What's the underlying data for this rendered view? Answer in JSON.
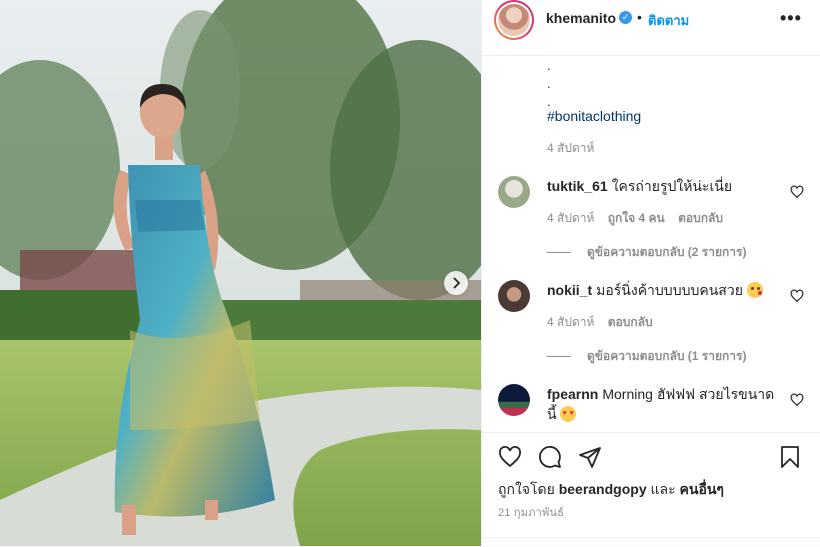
{
  "post": {
    "username": "khemanito",
    "follow_label": "ติดตาม",
    "separator": "•",
    "more_label": "•••",
    "verified_mark": "✓",
    "next_icon": "chevron-right-icon"
  },
  "caption": {
    "dots": [
      ".",
      ".",
      "."
    ],
    "hashtag": "#bonitaclothing",
    "time": "4 สัปดาห์"
  },
  "comments": [
    {
      "username": "tuktik_61",
      "text": "ใครถ่ายรูปให้น่ะเนี่ย",
      "time": "4 สัปดาห์",
      "likes": "ถูกใจ 4 คน",
      "reply": "ตอบกลับ",
      "view_replies": "ดูข้อความตอบกลับ (2 รายการ)"
    },
    {
      "username": "nokii_t",
      "text": "มอร์นิ่งค้าบบบบบคนสวย",
      "emoji": "kissing-face",
      "time": "4 สัปดาห์",
      "reply": "ตอบกลับ",
      "view_replies": "ดูข้อความตอบกลับ (1 รายการ)"
    },
    {
      "username": "fpearnn",
      "text": "Morning ฮัฟฟฟ สวยไรขนาดนี้",
      "emoji": "heart-eyes-face"
    }
  ],
  "footer": {
    "liked_prefix": "ถูกใจโดย",
    "liked_user": "beerandgopy",
    "liked_and": "และ",
    "liked_others": "คนอื่นๆ",
    "date": "21 กุมภาพันธ์"
  },
  "colors": {
    "link": "#0095f6",
    "hashtag": "#00376b",
    "muted": "#8e8e8e",
    "text": "#262626"
  }
}
